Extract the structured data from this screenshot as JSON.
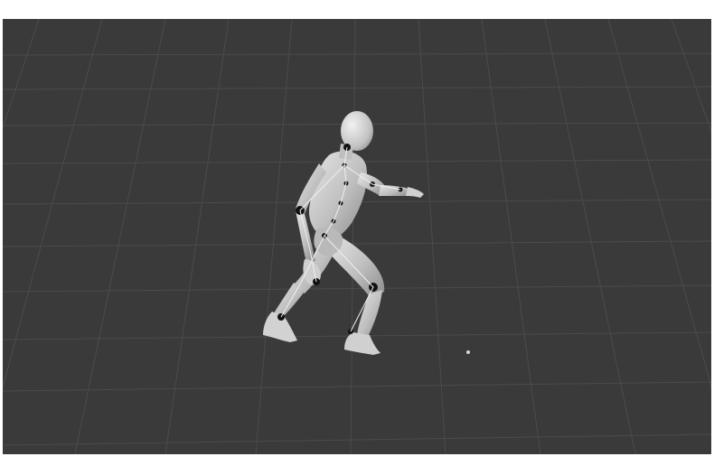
{
  "viewport": {
    "background_color": "#3a3a3b",
    "grid_color": "#4a4a4c",
    "grid_line_color_strong": "#545457",
    "model_color": "#cfcfcf",
    "joint_color": "#111111",
    "origin_point_color": "#d8d8d8"
  },
  "icons": {
    "origin": "origin-point-icon"
  }
}
